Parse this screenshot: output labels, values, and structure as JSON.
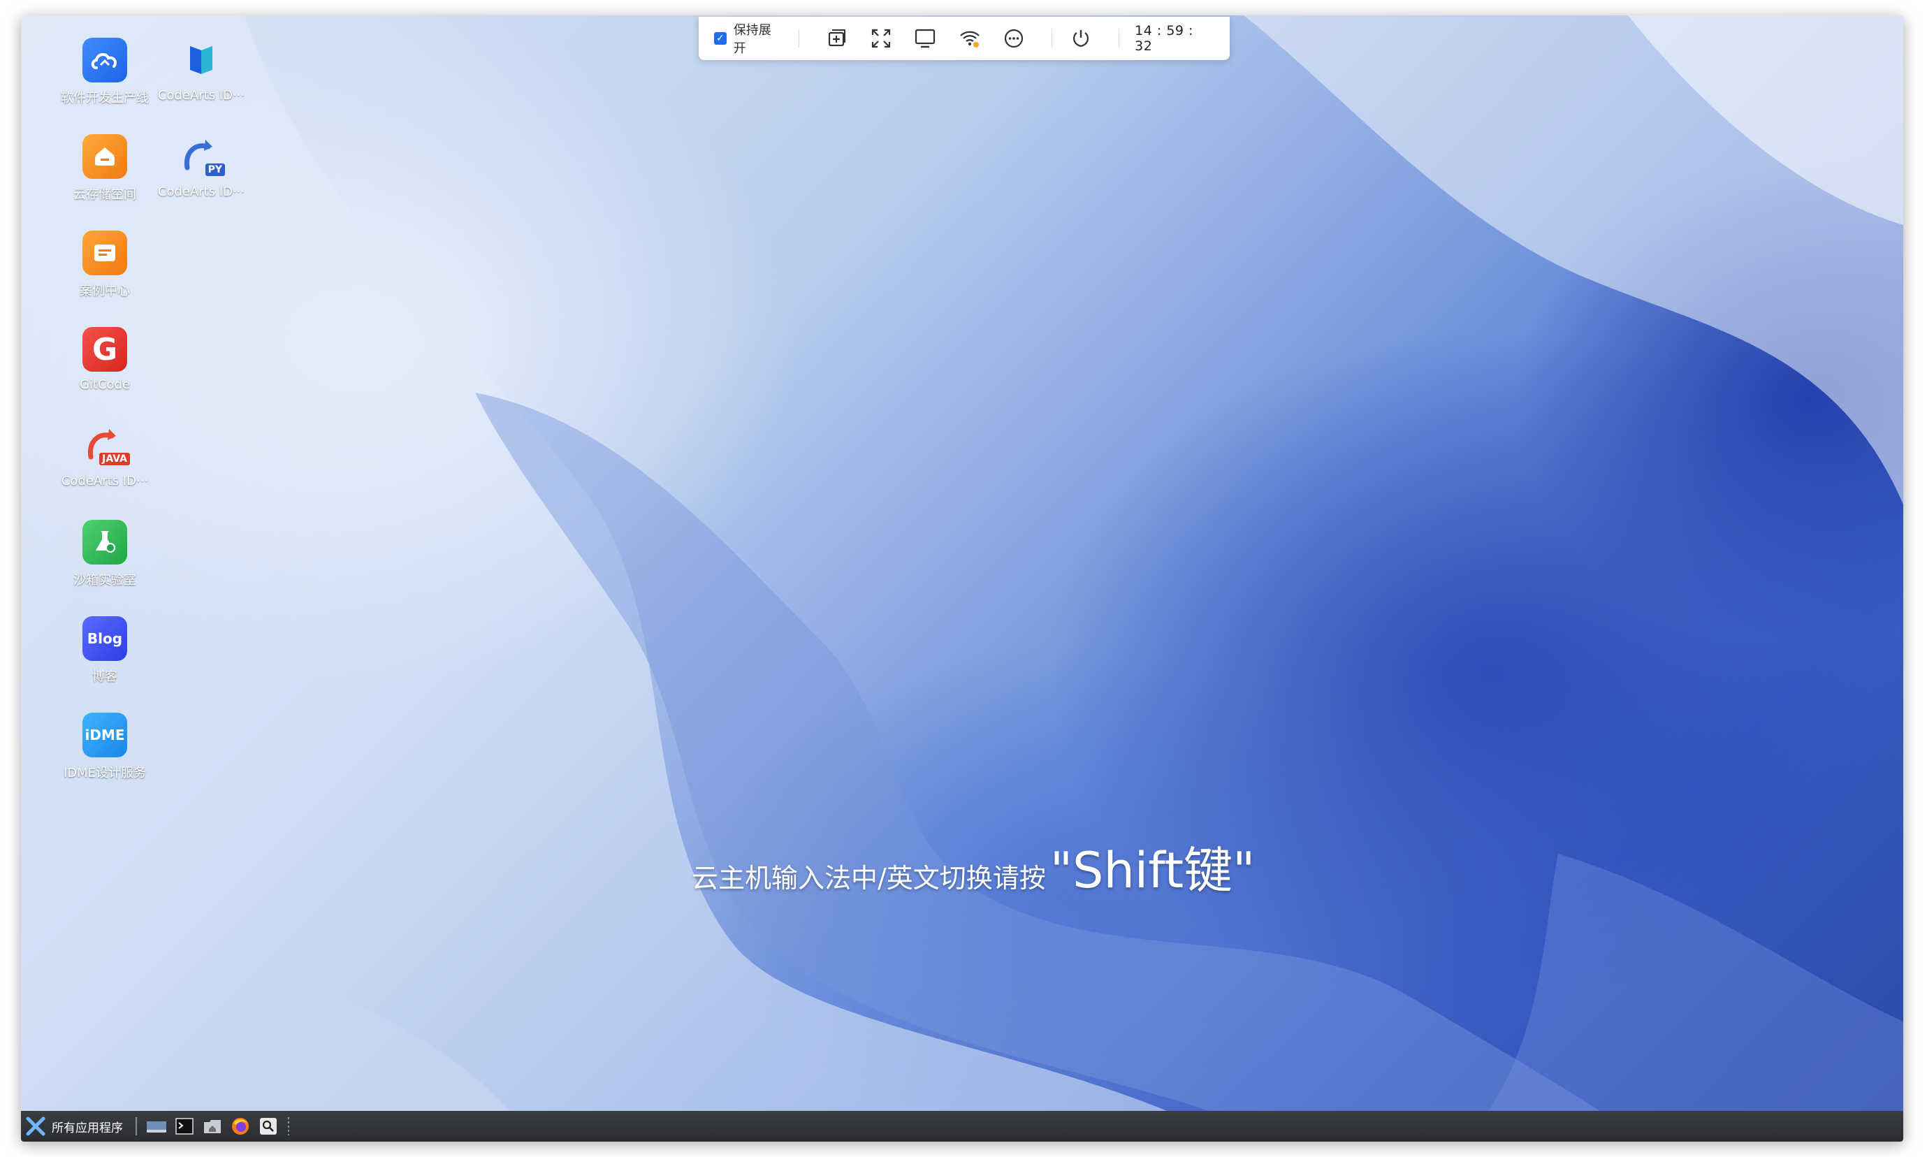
{
  "desktop_icons": [
    {
      "label": "软件开发生产线",
      "icon": "cloud-devops-icon"
    },
    {
      "label": "CodeArts ID···",
      "icon": "codearts-ide-icon"
    },
    {
      "label": "云存储空间",
      "icon": "cloud-storage-icon"
    },
    {
      "label": "CodeArts ID···",
      "icon": "codearts-python-icon"
    },
    {
      "label": "案例中心",
      "icon": "case-center-icon"
    },
    {
      "label": "GitCode",
      "icon": "gitcode-icon"
    },
    {
      "label": "CodeArts ID···",
      "icon": "codearts-java-icon"
    },
    {
      "label": "沙箱实验室",
      "icon": "sandbox-lab-icon"
    },
    {
      "label": "博客",
      "icon": "blog-icon"
    },
    {
      "label": "IDME设计服务",
      "icon": "idme-icon"
    }
  ],
  "icon_glyphs": {
    "py_badge": "PY",
    "java_badge": "JAVA",
    "blog": "Blog",
    "idme": "iDME",
    "gitcode": "G"
  },
  "toolbar": {
    "keep_open_label": "保持展开",
    "time": "14 : 59 : 32"
  },
  "ime_hint": {
    "prefix": "云主机输入法中/英文切换请按",
    "key": "\"Shift键\""
  },
  "taskbar": {
    "start_label": "所有应用程序"
  },
  "colors": {
    "toolbar_check": "#1e6cf0",
    "taskbar_bg": "#2b2d31"
  }
}
